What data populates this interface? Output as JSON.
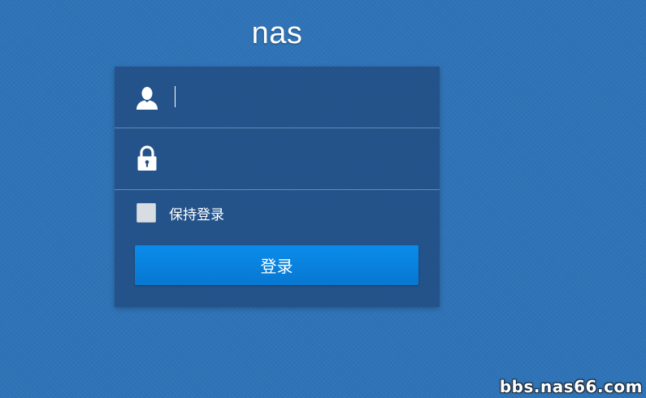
{
  "app": {
    "title": "nas"
  },
  "login": {
    "username": {
      "value": "",
      "placeholder": "",
      "icon": "user-icon"
    },
    "password": {
      "value": "",
      "placeholder": "",
      "icon": "lock-icon"
    },
    "remember_me": {
      "label": "保持登录",
      "checked": false
    },
    "submit_label": "登录"
  },
  "watermark": {
    "text": "bbs.nas66.com"
  },
  "colors": {
    "background": "#2f73b7",
    "panel": "#264f80",
    "button": "#0a84e0",
    "text": "#ffffff"
  }
}
